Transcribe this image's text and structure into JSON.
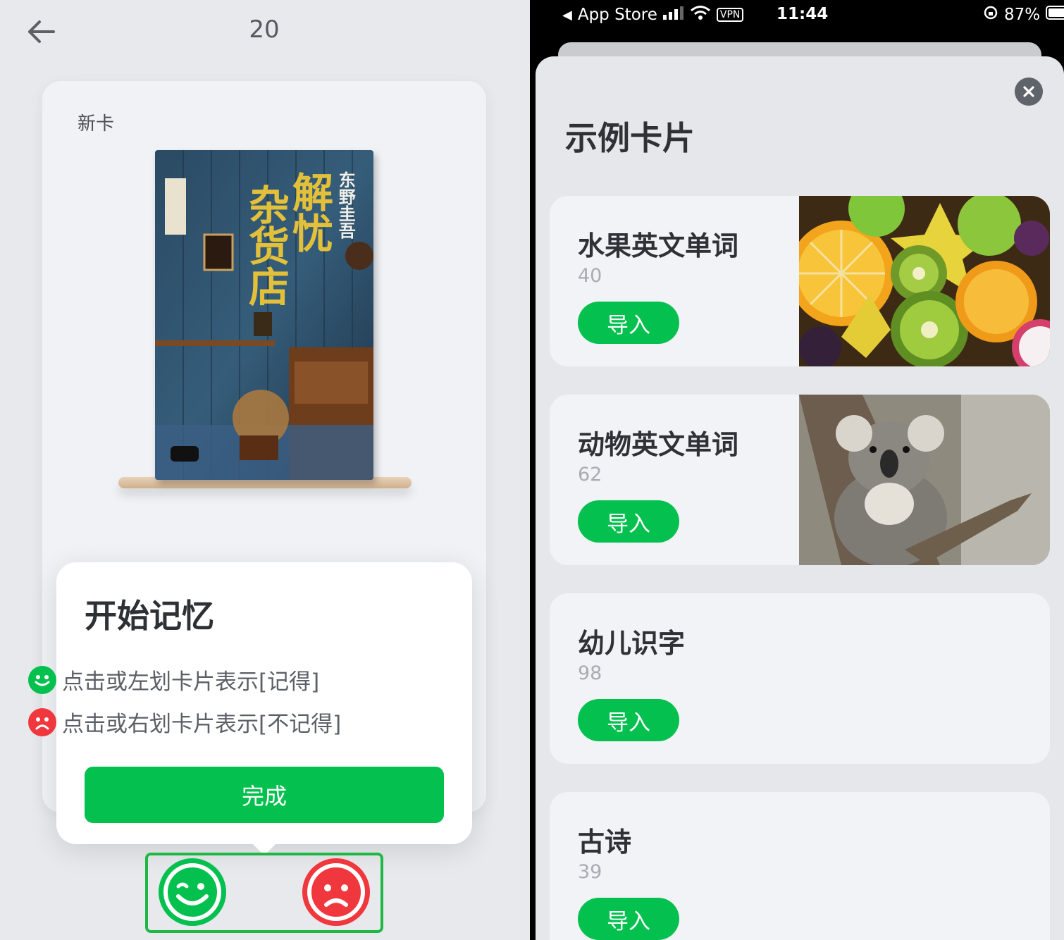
{
  "left": {
    "counter": "20",
    "card_tag": "新卡",
    "book": {
      "title_line1": "解忧",
      "title_line2": "杂货店",
      "author": "东野圭吾"
    },
    "tip": {
      "title": "开始记忆",
      "line_remember": "点击或左划卡片表示[记得]",
      "line_forget": "点击或右划卡片表示[不记得]",
      "done_label": "完成"
    }
  },
  "right": {
    "status": {
      "carrier": "App Store",
      "vpn": "VPN",
      "time": "11:44",
      "battery": "87%"
    },
    "title": "示例卡片",
    "import_label": "导入",
    "decks": [
      {
        "name": "水果英文单词",
        "count": "40",
        "image": "fruit-photo"
      },
      {
        "name": "动物英文单词",
        "count": "62",
        "image": "koala-photo"
      },
      {
        "name": "幼儿识字",
        "count": "98"
      },
      {
        "name": "古诗",
        "count": "39"
      }
    ]
  },
  "colors": {
    "green": "#04c04e",
    "red": "#f0373d",
    "text_dark": "#2e3136",
    "text_muted": "#a8acb2"
  }
}
